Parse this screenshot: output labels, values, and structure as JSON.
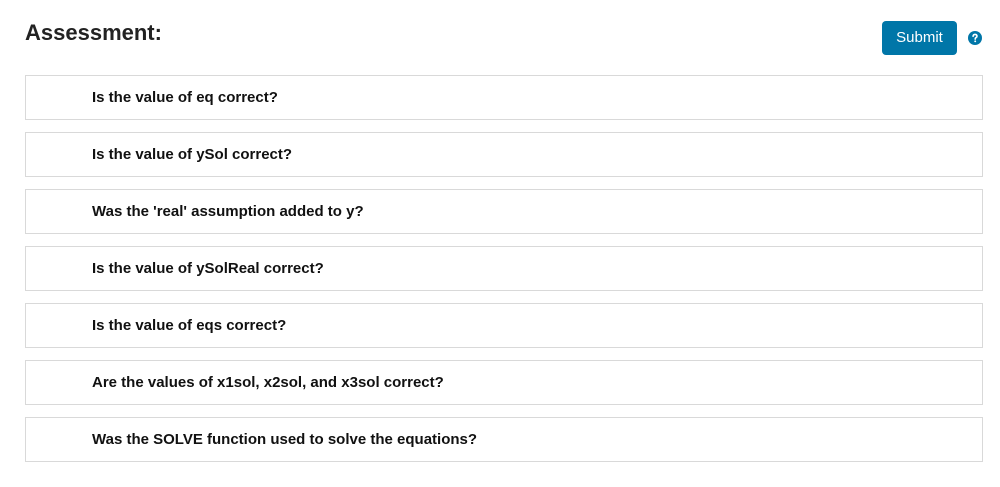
{
  "header": {
    "title": "Assessment:",
    "submit_label": "Submit",
    "help_icon": "question-circle-icon",
    "accent_color": "#0076a8"
  },
  "tests": [
    {
      "label": "Is the value of eq correct?"
    },
    {
      "label": "Is the value of ySol correct?"
    },
    {
      "label": "Was the 'real' assumption added to y?"
    },
    {
      "label": "Is the value of ySolReal correct?"
    },
    {
      "label": "Is the value of eqs correct?"
    },
    {
      "label": "Are the values of x1sol, x2sol, and x3sol correct?"
    },
    {
      "label": "Was the SOLVE function used to solve the equations?"
    }
  ]
}
